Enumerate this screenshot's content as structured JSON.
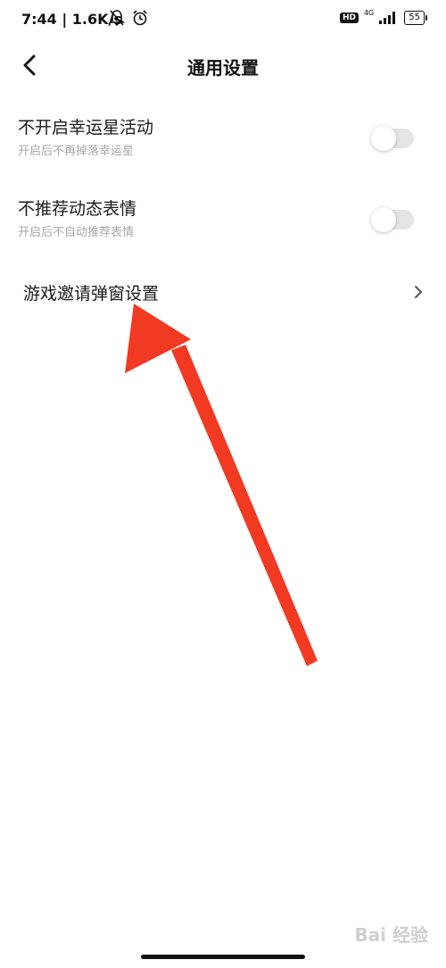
{
  "status_bar": {
    "time": "7:44 | 1.6K/s",
    "hd": "HD",
    "network": "4G",
    "battery": "55"
  },
  "header": {
    "title": "通用设置"
  },
  "settings": [
    {
      "label": "不开启幸运星活动",
      "description": "开启后不再掉落幸运星",
      "enabled": false
    },
    {
      "label": "不推荐动态表情",
      "description": "开启后不自动推荐表情",
      "enabled": false
    }
  ],
  "nav_item": {
    "label": "游戏邀请弹窗设置"
  },
  "colors": {
    "annotation_arrow": "#f23a23",
    "toggle_off": "#e5e5e5"
  },
  "watermark": "Bai 经验"
}
